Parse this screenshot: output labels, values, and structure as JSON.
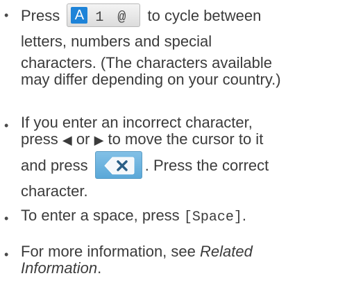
{
  "bullets": {
    "symbol": "•"
  },
  "item1": {
    "line1_pre": "Press",
    "key_a": "A",
    "key_1": "1",
    "key_at": "@",
    "line1_post": "to cycle between",
    "line2": "letters, numbers and special",
    "line3": "characters. (The characters available",
    "line4": "may differ depending on your country.)"
  },
  "item2": {
    "line1": "If you enter an incorrect character,",
    "line2_pre": "press",
    "left_arrow": "◀",
    "line2_mid": "or",
    "right_arrow": "▶",
    "line2_post": "to move the cursor to it",
    "line3_pre": "and press",
    "backspace_icon": "backspace-x-icon",
    "line3_post": ". Press the correct",
    "line4": "character."
  },
  "item3": {
    "pre": "To enter a space, press",
    "code": "[Space]",
    "post": "."
  },
  "item4": {
    "line1_pre": "For more information, see",
    "line1_em": "Related",
    "line2_em": "Information",
    "line2_post": "."
  },
  "colors": {
    "text": "#3b3b3b",
    "key_accent": "#1e83d8",
    "backspace_bg": "#6cb4e0"
  }
}
